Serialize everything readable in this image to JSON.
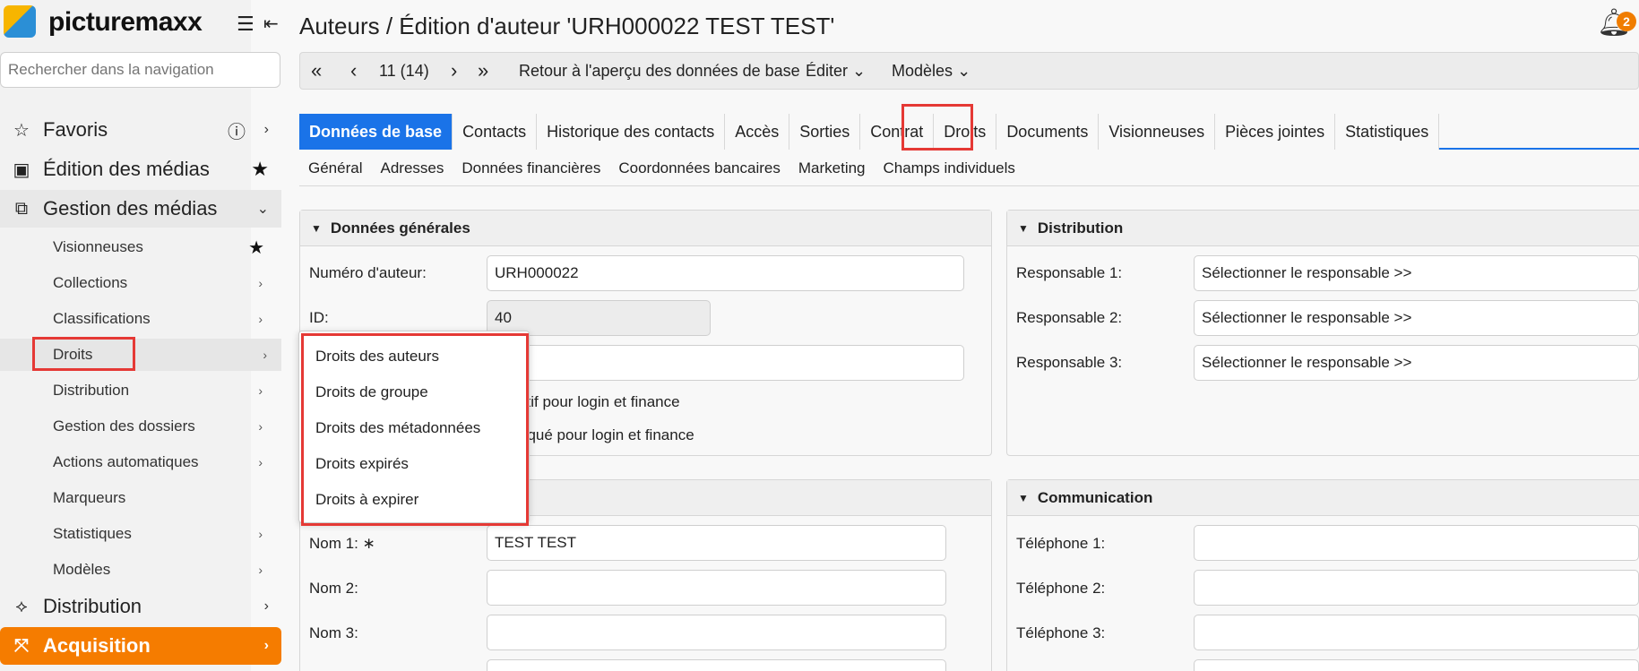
{
  "brand": {
    "name": "picturemaxx"
  },
  "sidebar": {
    "search_placeholder": "Rechercher dans la navigation",
    "main": [
      {
        "label": "Favoris"
      },
      {
        "label": "Édition des médias"
      },
      {
        "label": "Gestion des médias"
      },
      {
        "label": "Distribution"
      },
      {
        "label": "Acquisition"
      }
    ],
    "sub": [
      {
        "label": "Visionneuses"
      },
      {
        "label": "Collections"
      },
      {
        "label": "Classifications"
      },
      {
        "label": "Droits"
      },
      {
        "label": "Distribution"
      },
      {
        "label": "Gestion des dossiers"
      },
      {
        "label": "Actions automatiques"
      },
      {
        "label": "Marqueurs"
      },
      {
        "label": "Statistiques"
      },
      {
        "label": "Modèles"
      }
    ]
  },
  "header": {
    "title": "Auteurs / Édition d'auteur 'URH000022 TEST TEST'",
    "notification_count": "2"
  },
  "toolbar": {
    "position": "11 (14)",
    "back_label": "Retour à l'aperçu des données de base",
    "edit_label": "Éditer",
    "templates_label": "Modèles"
  },
  "tabs": [
    "Données de base",
    "Contacts",
    "Historique des contacts",
    "Accès",
    "Sorties",
    "Contrat",
    "Droits",
    "Documents",
    "Visionneuses",
    "Pièces jointes",
    "Statistiques"
  ],
  "subtabs": [
    "Général",
    "Adresses",
    "Données financières",
    "Coordonnées bancaires",
    "Marketing",
    "Champs individuels"
  ],
  "general": {
    "title": "Données générales",
    "author_number_label": "Numéro d'auteur:",
    "author_number": "URH000022",
    "id_label": "ID:",
    "id": "40",
    "active_text": "ctif pour login et finance",
    "blocked_text": "oqué pour login et finance"
  },
  "distribution": {
    "title": "Distribution",
    "resp1_label": "Responsable 1:",
    "resp2_label": "Responsable 2:",
    "resp3_label": "Responsable 3:",
    "select_text": "Sélectionner le responsable >>"
  },
  "names": {
    "nom1_label": "Nom 1:",
    "nom1": "TEST TEST",
    "nom2_label": "Nom 2:",
    "nom3_label": "Nom 3:"
  },
  "communication": {
    "title": "Communication",
    "tel1_label": "Téléphone 1:",
    "tel2_label": "Téléphone 2:",
    "tel3_label": "Téléphone 3:"
  },
  "rights_menu": [
    "Droits des auteurs",
    "Droits de groupe",
    "Droits des métadonnées",
    "Droits expirés",
    "Droits à expirer"
  ],
  "colors": {
    "accent": "#1a73e8",
    "brand_orange": "#f57c00",
    "highlight": "#e53935"
  }
}
